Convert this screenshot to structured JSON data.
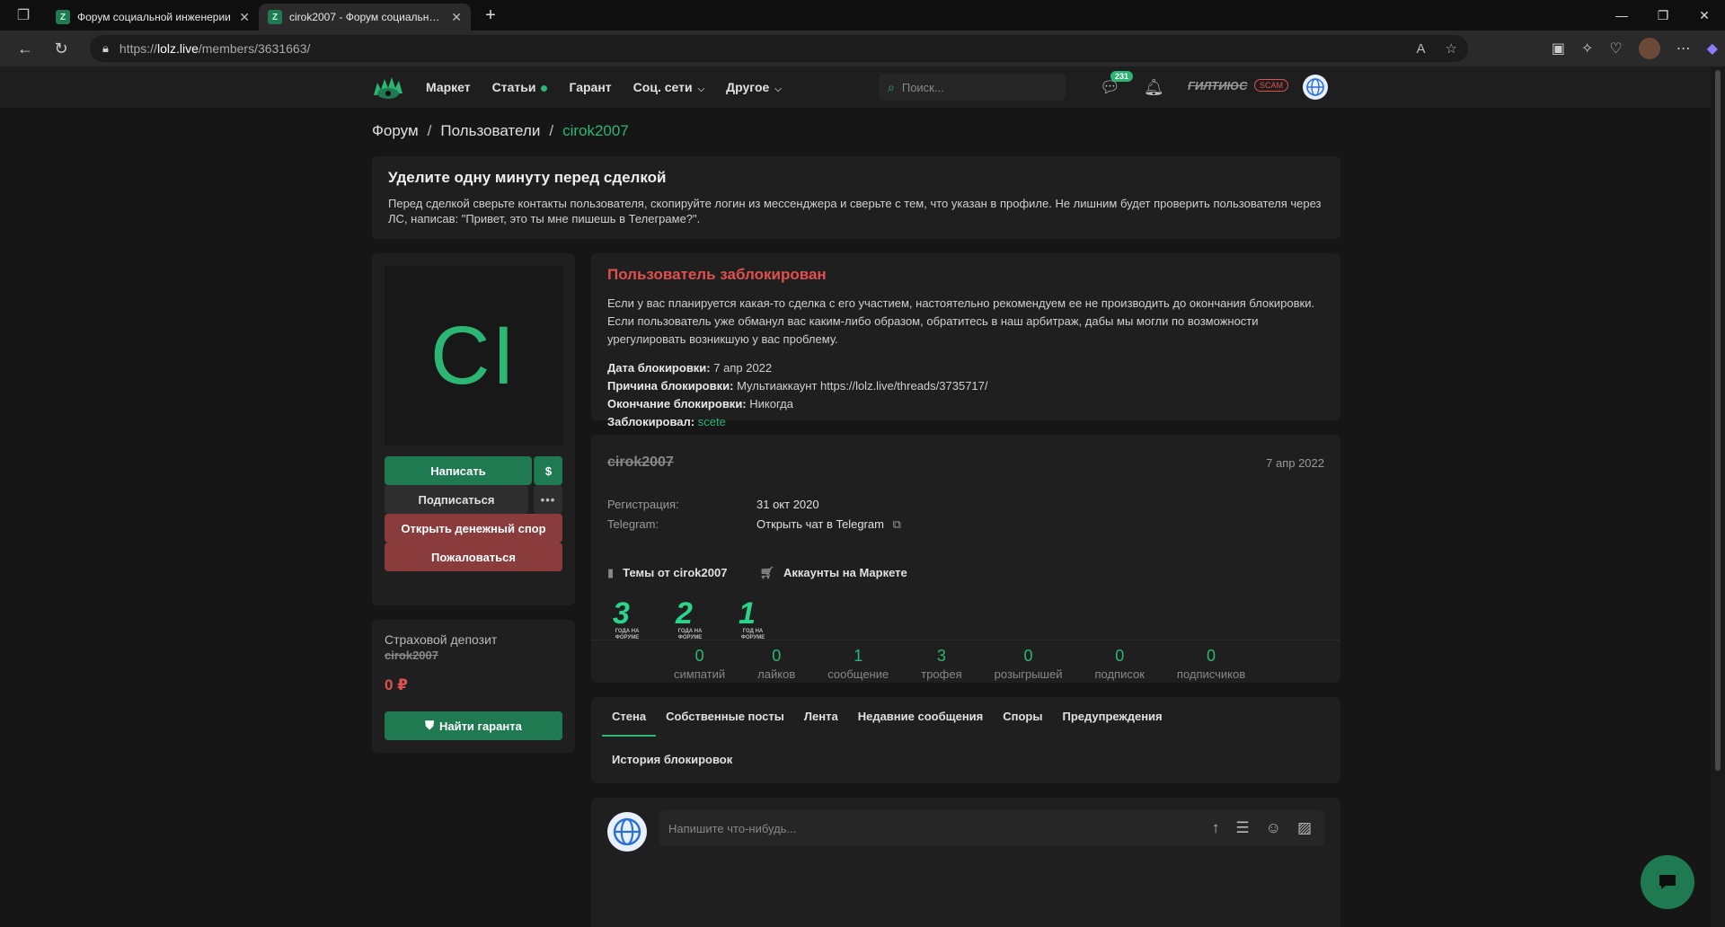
{
  "browser": {
    "tabs": [
      {
        "title": "Форум социальной инженерии"
      },
      {
        "title": "cirok2007 - Форум социальной и"
      }
    ],
    "url_prefix": "https://",
    "url_domain": "lolz.live",
    "url_path": "/members/3631663/"
  },
  "nav": {
    "items": [
      {
        "label": "Маркет"
      },
      {
        "label": "Статьи"
      },
      {
        "label": "Гарант"
      },
      {
        "label": "Соц. сети"
      },
      {
        "label": "Другое"
      }
    ],
    "search_placeholder": "Поиск...",
    "messages_count": "231",
    "username": "ГИЛТИЮС",
    "scam_badge": "SCAM"
  },
  "breadcrumb": {
    "forum": "Форум",
    "users": "Пользователи",
    "current": "cirok2007"
  },
  "notice": {
    "title": "Уделите одну минуту перед сделкой",
    "text": "Перед сделкой сверьте контакты пользователя, скопируйте логин из мессенджера и сверьте с тем, что указан в профиле. Не лишним будет проверить пользователя через ЛС, написав: \"Привет, это ты мне пишешь в Телеграме?\"."
  },
  "profile_card": {
    "avatar_initials": "CI",
    "write_button": "Написать",
    "dollar": "$",
    "subscribe_button": "Подписаться",
    "more": "•••",
    "dispute_button": "Открыть денежный спор",
    "report_button": "Пожаловаться"
  },
  "deposit": {
    "title": "Страховой депозит",
    "username": "cirok2007",
    "amount": "0 ₽",
    "guarantor_button": "Найти гаранта"
  },
  "ban": {
    "title": "Пользователь заблокирован",
    "description": "Если у вас планируется какая-то сделка с его участием, настоятельно рекомендуем ее не производить до окончания блокировки. Если пользователь уже обманул вас каким-либо образом, обратитесь в наш арбитраж, дабы мы могли по возможности урегулировать возникшую у вас проблему.",
    "date_label": "Дата блокировки:",
    "date_value": "7 апр 2022",
    "reason_label": "Причина блокировки:",
    "reason_value": "Мультиаккаунт https://lolz.live/threads/3735717/",
    "end_label": "Окончание блокировки:",
    "end_value": "Никогда",
    "by_label": "Заблокировал:",
    "by_value": "scete"
  },
  "profile": {
    "username": "cirok2007",
    "last_seen": "7 апр 2022",
    "reg_label": "Регистрация:",
    "reg_value": "31 окт 2020",
    "tg_label": "Telegram:",
    "tg_value": "Открыть чат в Telegram",
    "threads_link": "Темы от cirok2007",
    "market_link": "Аккаунты на Маркете",
    "trophies": [
      {
        "num": "3",
        "caption": "ГОДА НА ФОРУМЕ"
      },
      {
        "num": "2",
        "caption": "ГОДА НА ФОРУМЕ"
      },
      {
        "num": "1",
        "caption": "ГОД НА ФОРУМЕ"
      }
    ],
    "stats": [
      {
        "value": "0",
        "label": "симпатий"
      },
      {
        "value": "0",
        "label": "лайков"
      },
      {
        "value": "1",
        "label": "сообщение"
      },
      {
        "value": "3",
        "label": "трофея"
      },
      {
        "value": "0",
        "label": "розыгрышей"
      },
      {
        "value": "0",
        "label": "подписок"
      },
      {
        "value": "0",
        "label": "подписчиков"
      }
    ]
  },
  "profile_tabs": {
    "items": [
      {
        "label": "Стена"
      },
      {
        "label": "Собственные посты"
      },
      {
        "label": "Лента"
      },
      {
        "label": "Недавние сообщения"
      },
      {
        "label": "Споры"
      },
      {
        "label": "Предупреждения"
      }
    ],
    "second_row": "История блокировок"
  },
  "wall": {
    "placeholder": "Напишите что-нибудь..."
  },
  "colors": {
    "accent": "#2bb673",
    "danger": "#e05050",
    "background": "#161616",
    "card": "#1f1f1f"
  }
}
